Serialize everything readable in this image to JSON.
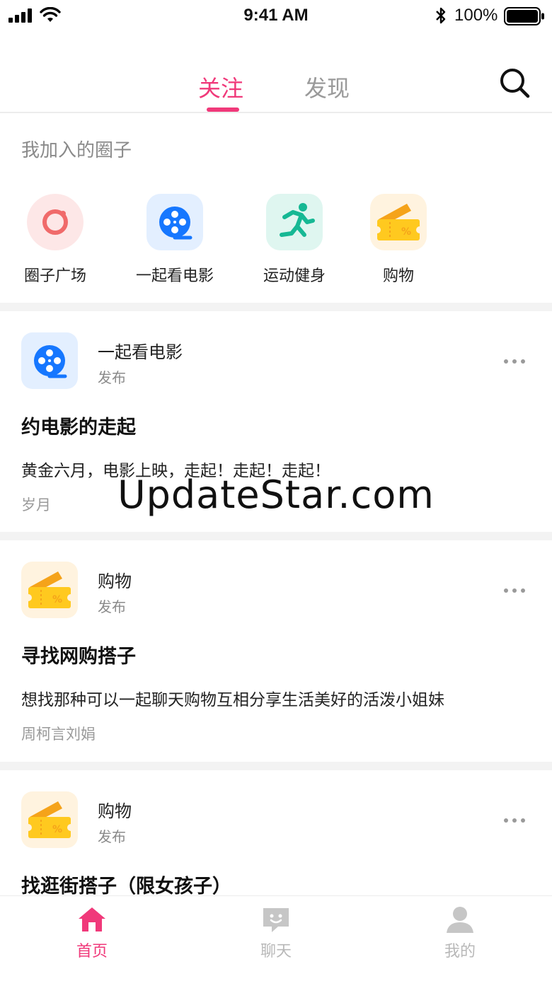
{
  "status_bar": {
    "time": "9:41 AM",
    "battery": "100%"
  },
  "header": {
    "tab_follow": "关注",
    "tab_discover": "发现",
    "active_color": "#f0397a"
  },
  "circles": {
    "title": "我加入的圈子",
    "items": [
      {
        "label": "圈子广场",
        "icon": "circle-plaza-icon"
      },
      {
        "label": "一起看电影",
        "icon": "film-reel-icon"
      },
      {
        "label": "运动健身",
        "icon": "running-person-icon"
      },
      {
        "label": "购物",
        "icon": "coupon-ticket-icon"
      }
    ]
  },
  "posts": [
    {
      "circle": "一起看电影",
      "action": "发布",
      "title": "约电影的走起",
      "body": "黄金六月，电影上映，走起！走起！走起！",
      "author": "岁月",
      "icon": "film-reel-icon"
    },
    {
      "circle": "购物",
      "action": "发布",
      "title": "寻找网购搭子",
      "body": "想找那种可以一起聊天购物互相分享生活美好的活泼小姐妹",
      "author": "周柯言刘娟",
      "icon": "coupon-ticket-icon"
    },
    {
      "circle": "购物",
      "action": "发布",
      "title": "找逛街搭子（限女孩子）",
      "icon": "coupon-ticket-icon"
    }
  ],
  "watermark": "UpdateStar.com",
  "tabbar": {
    "items": [
      {
        "label": "首页",
        "icon": "home-icon",
        "active": true
      },
      {
        "label": "聊天",
        "icon": "chat-icon",
        "active": false
      },
      {
        "label": "我的",
        "icon": "profile-icon",
        "active": false
      }
    ]
  }
}
